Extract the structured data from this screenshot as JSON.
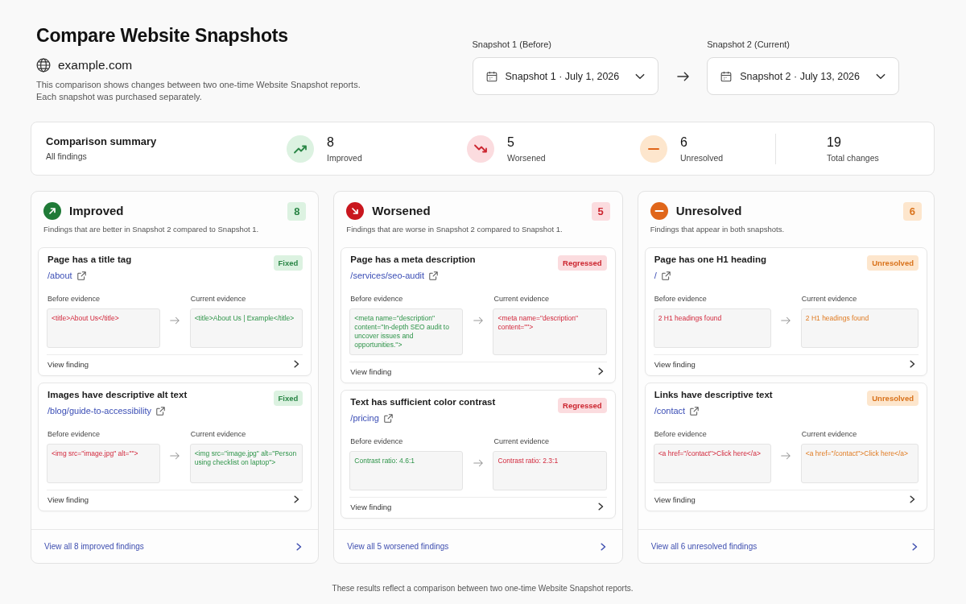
{
  "header": {
    "title": "Compare Website Snapshots",
    "site": "example.com",
    "description": [
      "This comparison shows changes between two one-time Website Snapshot reports.",
      "Each snapshot was purchased separately."
    ]
  },
  "snapshots": [
    {
      "label": "Snapshot 1 (Before)",
      "value": "Snapshot 1 · July 1, 2026"
    },
    {
      "label": "Snapshot 2 (Current)",
      "value": "Snapshot 2 · July 13, 2026"
    }
  ],
  "summary": {
    "title": "Comparison summary",
    "subtitle": "All findings",
    "stats": [
      {
        "kind": "improved",
        "count": "8",
        "label": "Improved"
      },
      {
        "kind": "worsened",
        "count": "5",
        "label": "Worsened"
      },
      {
        "kind": "unresolved",
        "count": "6",
        "label": "Unresolved"
      },
      {
        "kind": "total",
        "count": "19",
        "label": "Total changes"
      }
    ]
  },
  "columns": [
    {
      "kind": "improved",
      "title": "Improved",
      "count": "8",
      "description": "Findings that are better in Snapshot 2 compared to Snapshot 1.",
      "findings": [
        {
          "title": "Page has a title tag",
          "path": "/about",
          "status": "Fixed",
          "evidence": [
            {
              "label": "Before evidence",
              "text": "<title>About Us</title>",
              "kind": "negative"
            },
            {
              "label": "Current evidence",
              "text": "<title>About Us | Example</title>",
              "kind": "positive"
            }
          ],
          "action": "View finding"
        },
        {
          "title": "Images have descriptive alt text",
          "path": "/blog/guide-to-accessibility",
          "status": "Fixed",
          "evidence": [
            {
              "label": "Before evidence",
              "text": "<img src=\"image.jpg\" alt=\"\">",
              "kind": "negative"
            },
            {
              "label": "Current evidence",
              "text": "<img src=\"image.jpg\" alt=\"Person using checklist on laptop\">",
              "kind": "positive"
            }
          ],
          "action": "View finding"
        }
      ],
      "view_all": "View all 8 improved findings"
    },
    {
      "kind": "worsened",
      "title": "Worsened",
      "count": "5",
      "description": "Findings that are worse in Snapshot 2 compared to Snapshot 1.",
      "findings": [
        {
          "title": "Page has a meta description",
          "path": "/services/seo-audit",
          "status": "Regressed",
          "evidence": [
            {
              "label": "Before evidence",
              "text": "<meta name=\"description\" content=\"In-depth SEO audit to uncover issues and opportunities.\">",
              "kind": "positive"
            },
            {
              "label": "Current evidence",
              "text": "<meta name=\"description\" content=\"\">",
              "kind": "negative"
            }
          ],
          "action": "View finding"
        },
        {
          "title": "Text has sufficient color contrast",
          "path": "/pricing",
          "status": "Regressed",
          "evidence": [
            {
              "label": "Before evidence",
              "text": "Contrast ratio: 4.6:1",
              "kind": "positive"
            },
            {
              "label": "Current evidence",
              "text": "Contrast ratio: 2.3:1",
              "kind": "negative"
            }
          ],
          "action": "View finding"
        }
      ],
      "view_all": "View all 5 worsened findings"
    },
    {
      "kind": "unresolved",
      "title": "Unresolved",
      "count": "6",
      "description": "Findings that appear in both snapshots.",
      "findings": [
        {
          "title": "Page has one H1 heading",
          "path": "/",
          "status": "Unresolved",
          "evidence": [
            {
              "label": "Before evidence",
              "text": "2 H1 headings found",
              "kind": "negative"
            },
            {
              "label": "Current evidence",
              "text": "2 H1 headings found",
              "kind": "neutral"
            }
          ],
          "action": "View finding"
        },
        {
          "title": "Links have descriptive text",
          "path": "/contact",
          "status": "Unresolved",
          "evidence": [
            {
              "label": "Before evidence",
              "text": "<a href=\"/contact\">Click here</a>",
              "kind": "negative"
            },
            {
              "label": "Current evidence",
              "text": "<a href=\"/contact\">Click here</a>",
              "kind": "neutral"
            }
          ],
          "action": "View finding"
        }
      ],
      "view_all": "View all 6 unresolved findings"
    }
  ],
  "footer": "These results reflect a comparison between two one-time Website Snapshot reports."
}
